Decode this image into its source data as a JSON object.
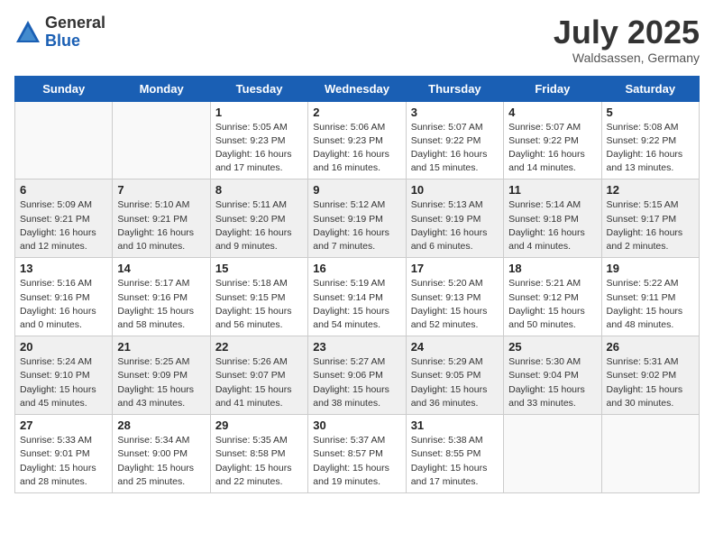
{
  "header": {
    "logo_general": "General",
    "logo_blue": "Blue",
    "month_title": "July 2025",
    "location": "Waldsassen, Germany"
  },
  "weekdays": [
    "Sunday",
    "Monday",
    "Tuesday",
    "Wednesday",
    "Thursday",
    "Friday",
    "Saturday"
  ],
  "weeks": [
    [
      {
        "day": "",
        "info": ""
      },
      {
        "day": "",
        "info": ""
      },
      {
        "day": "1",
        "info": "Sunrise: 5:05 AM\nSunset: 9:23 PM\nDaylight: 16 hours\nand 17 minutes."
      },
      {
        "day": "2",
        "info": "Sunrise: 5:06 AM\nSunset: 9:23 PM\nDaylight: 16 hours\nand 16 minutes."
      },
      {
        "day": "3",
        "info": "Sunrise: 5:07 AM\nSunset: 9:22 PM\nDaylight: 16 hours\nand 15 minutes."
      },
      {
        "day": "4",
        "info": "Sunrise: 5:07 AM\nSunset: 9:22 PM\nDaylight: 16 hours\nand 14 minutes."
      },
      {
        "day": "5",
        "info": "Sunrise: 5:08 AM\nSunset: 9:22 PM\nDaylight: 16 hours\nand 13 minutes."
      }
    ],
    [
      {
        "day": "6",
        "info": "Sunrise: 5:09 AM\nSunset: 9:21 PM\nDaylight: 16 hours\nand 12 minutes."
      },
      {
        "day": "7",
        "info": "Sunrise: 5:10 AM\nSunset: 9:21 PM\nDaylight: 16 hours\nand 10 minutes."
      },
      {
        "day": "8",
        "info": "Sunrise: 5:11 AM\nSunset: 9:20 PM\nDaylight: 16 hours\nand 9 minutes."
      },
      {
        "day": "9",
        "info": "Sunrise: 5:12 AM\nSunset: 9:19 PM\nDaylight: 16 hours\nand 7 minutes."
      },
      {
        "day": "10",
        "info": "Sunrise: 5:13 AM\nSunset: 9:19 PM\nDaylight: 16 hours\nand 6 minutes."
      },
      {
        "day": "11",
        "info": "Sunrise: 5:14 AM\nSunset: 9:18 PM\nDaylight: 16 hours\nand 4 minutes."
      },
      {
        "day": "12",
        "info": "Sunrise: 5:15 AM\nSunset: 9:17 PM\nDaylight: 16 hours\nand 2 minutes."
      }
    ],
    [
      {
        "day": "13",
        "info": "Sunrise: 5:16 AM\nSunset: 9:16 PM\nDaylight: 16 hours\nand 0 minutes."
      },
      {
        "day": "14",
        "info": "Sunrise: 5:17 AM\nSunset: 9:16 PM\nDaylight: 15 hours\nand 58 minutes."
      },
      {
        "day": "15",
        "info": "Sunrise: 5:18 AM\nSunset: 9:15 PM\nDaylight: 15 hours\nand 56 minutes."
      },
      {
        "day": "16",
        "info": "Sunrise: 5:19 AM\nSunset: 9:14 PM\nDaylight: 15 hours\nand 54 minutes."
      },
      {
        "day": "17",
        "info": "Sunrise: 5:20 AM\nSunset: 9:13 PM\nDaylight: 15 hours\nand 52 minutes."
      },
      {
        "day": "18",
        "info": "Sunrise: 5:21 AM\nSunset: 9:12 PM\nDaylight: 15 hours\nand 50 minutes."
      },
      {
        "day": "19",
        "info": "Sunrise: 5:22 AM\nSunset: 9:11 PM\nDaylight: 15 hours\nand 48 minutes."
      }
    ],
    [
      {
        "day": "20",
        "info": "Sunrise: 5:24 AM\nSunset: 9:10 PM\nDaylight: 15 hours\nand 45 minutes."
      },
      {
        "day": "21",
        "info": "Sunrise: 5:25 AM\nSunset: 9:09 PM\nDaylight: 15 hours\nand 43 minutes."
      },
      {
        "day": "22",
        "info": "Sunrise: 5:26 AM\nSunset: 9:07 PM\nDaylight: 15 hours\nand 41 minutes."
      },
      {
        "day": "23",
        "info": "Sunrise: 5:27 AM\nSunset: 9:06 PM\nDaylight: 15 hours\nand 38 minutes."
      },
      {
        "day": "24",
        "info": "Sunrise: 5:29 AM\nSunset: 9:05 PM\nDaylight: 15 hours\nand 36 minutes."
      },
      {
        "day": "25",
        "info": "Sunrise: 5:30 AM\nSunset: 9:04 PM\nDaylight: 15 hours\nand 33 minutes."
      },
      {
        "day": "26",
        "info": "Sunrise: 5:31 AM\nSunset: 9:02 PM\nDaylight: 15 hours\nand 30 minutes."
      }
    ],
    [
      {
        "day": "27",
        "info": "Sunrise: 5:33 AM\nSunset: 9:01 PM\nDaylight: 15 hours\nand 28 minutes."
      },
      {
        "day": "28",
        "info": "Sunrise: 5:34 AM\nSunset: 9:00 PM\nDaylight: 15 hours\nand 25 minutes."
      },
      {
        "day": "29",
        "info": "Sunrise: 5:35 AM\nSunset: 8:58 PM\nDaylight: 15 hours\nand 22 minutes."
      },
      {
        "day": "30",
        "info": "Sunrise: 5:37 AM\nSunset: 8:57 PM\nDaylight: 15 hours\nand 19 minutes."
      },
      {
        "day": "31",
        "info": "Sunrise: 5:38 AM\nSunset: 8:55 PM\nDaylight: 15 hours\nand 17 minutes."
      },
      {
        "day": "",
        "info": ""
      },
      {
        "day": "",
        "info": ""
      }
    ]
  ]
}
